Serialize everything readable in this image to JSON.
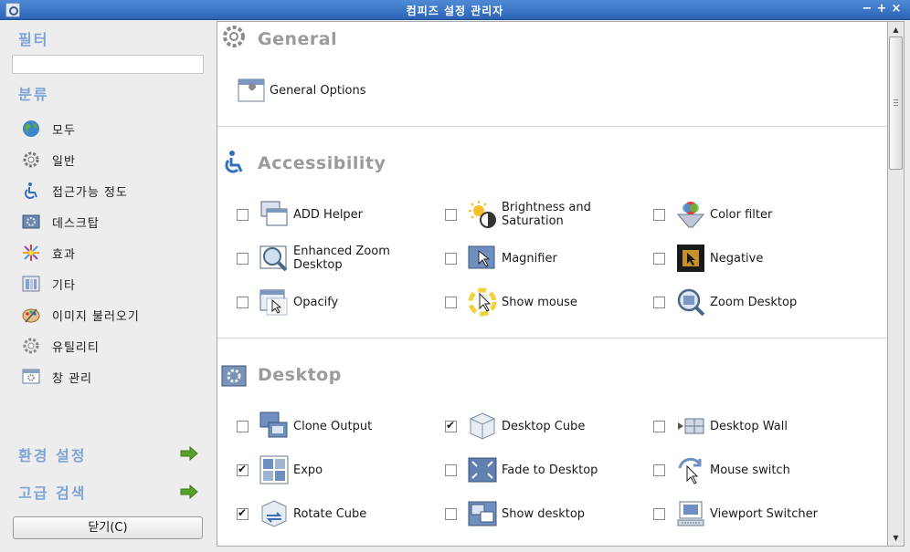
{
  "window": {
    "title": "컴피즈 설정 관리자",
    "controls": [
      "−",
      "+",
      "×"
    ]
  },
  "sidebar": {
    "filter_heading": "필터",
    "filter_value": "",
    "category_heading": "분류",
    "categories": [
      {
        "label": "모두",
        "icon": "globe-icon"
      },
      {
        "label": "일반",
        "icon": "gear-icon"
      },
      {
        "label": "접근가능 정도",
        "icon": "accessibility-icon"
      },
      {
        "label": "데스크탑",
        "icon": "desktop-icon"
      },
      {
        "label": "효과",
        "icon": "effects-icon"
      },
      {
        "label": "기타",
        "icon": "extras-icon"
      },
      {
        "label": "이미지 불러오기",
        "icon": "palette-icon"
      },
      {
        "label": "유틸리티",
        "icon": "utility-gear-icon"
      },
      {
        "label": "창 관리",
        "icon": "window-management-icon"
      }
    ],
    "preferences_label": "환경 설정",
    "advanced_search_label": "고급 검색",
    "close_label": "닫기(C)"
  },
  "main": {
    "sections": [
      {
        "title": "General",
        "icon": "general-gear-icon",
        "plugins": [
          {
            "label": "General Options",
            "icon": "general-options-icon",
            "checkbox": false
          }
        ]
      },
      {
        "title": "Accessibility",
        "icon": "accessibility-section-icon",
        "plugins": [
          {
            "label": "ADD Helper",
            "icon": "add-helper-icon",
            "checkbox": true,
            "checked": false
          },
          {
            "label": "Brightness and Saturation",
            "icon": "brightness-icon",
            "checkbox": true,
            "checked": false
          },
          {
            "label": "Color filter",
            "icon": "color-filter-icon",
            "checkbox": true,
            "checked": false
          },
          {
            "label": "Enhanced Zoom Desktop",
            "icon": "enhanced-zoom-icon",
            "checkbox": true,
            "checked": false
          },
          {
            "label": "Magnifier",
            "icon": "magnifier-icon",
            "checkbox": true,
            "checked": false
          },
          {
            "label": "Negative",
            "icon": "negative-icon",
            "checkbox": true,
            "checked": false
          },
          {
            "label": "Opacify",
            "icon": "opacify-icon",
            "checkbox": true,
            "checked": false
          },
          {
            "label": "Show mouse",
            "icon": "show-mouse-icon",
            "checkbox": true,
            "checked": false
          },
          {
            "label": "Zoom Desktop",
            "icon": "zoom-desktop-icon",
            "checkbox": true,
            "checked": false
          }
        ]
      },
      {
        "title": "Desktop",
        "icon": "desktop-section-icon",
        "plugins": [
          {
            "label": "Clone Output",
            "icon": "clone-output-icon",
            "checkbox": true,
            "checked": false
          },
          {
            "label": "Desktop Cube",
            "icon": "desktop-cube-icon",
            "checkbox": true,
            "checked": true
          },
          {
            "label": "Desktop Wall",
            "icon": "desktop-wall-icon",
            "checkbox": true,
            "checked": false
          },
          {
            "label": "Expo",
            "icon": "expo-icon",
            "checkbox": true,
            "checked": true
          },
          {
            "label": "Fade to Desktop",
            "icon": "fade-to-desktop-icon",
            "checkbox": true,
            "checked": false
          },
          {
            "label": "Mouse switch",
            "icon": "mouse-switch-icon",
            "checkbox": true,
            "checked": false
          },
          {
            "label": "Rotate Cube",
            "icon": "rotate-cube-icon",
            "checkbox": true,
            "checked": true
          },
          {
            "label": "Show desktop",
            "icon": "show-desktop-icon",
            "checkbox": true,
            "checked": false
          },
          {
            "label": "Viewport Switcher",
            "icon": "viewport-switcher-icon",
            "checkbox": true,
            "checked": false
          }
        ]
      }
    ]
  },
  "colors": {
    "titlebar": "#2b63b5",
    "heading": "#7fa4d4",
    "section_title": "#9b9b9b",
    "arrow_green": "#5aa12a"
  }
}
